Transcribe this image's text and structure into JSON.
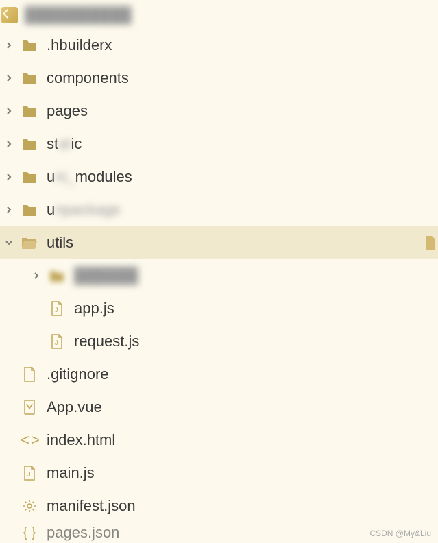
{
  "root": {
    "name_blurred": "██████████"
  },
  "tree": [
    {
      "type": "folder",
      "label": ".hbuilderx",
      "expanded": false,
      "level": 0
    },
    {
      "type": "folder",
      "label": "components",
      "expanded": false,
      "level": 0
    },
    {
      "type": "folder",
      "label": "pages",
      "expanded": false,
      "level": 0
    },
    {
      "type": "folder",
      "label": "static",
      "expanded": false,
      "level": 0,
      "blur_partial": true
    },
    {
      "type": "folder",
      "label": "uni_modules",
      "expanded": false,
      "level": 0,
      "blur_partial": true
    },
    {
      "type": "folder",
      "label": "unpackage",
      "expanded": false,
      "level": 0,
      "blur_partial": true
    },
    {
      "type": "folder",
      "label": "utils",
      "expanded": true,
      "level": 0,
      "selected": true,
      "badge": true
    },
    {
      "type": "folder",
      "label": "██████",
      "expanded": false,
      "level": 1,
      "blurred": true
    },
    {
      "type": "file-js",
      "label": "app.js",
      "level": 1
    },
    {
      "type": "file-js",
      "label": "request.js",
      "level": 1
    },
    {
      "type": "file",
      "label": ".gitignore",
      "level": 0
    },
    {
      "type": "file-vue",
      "label": "App.vue",
      "level": 0
    },
    {
      "type": "file-html",
      "label": "index.html",
      "level": 0
    },
    {
      "type": "file-js",
      "label": "main.js",
      "level": 0
    },
    {
      "type": "file-json-gear",
      "label": "manifest.json",
      "level": 0
    },
    {
      "type": "file-json",
      "label": "pages.json",
      "level": 0
    }
  ],
  "watermark": "CSDN @My&Liu"
}
